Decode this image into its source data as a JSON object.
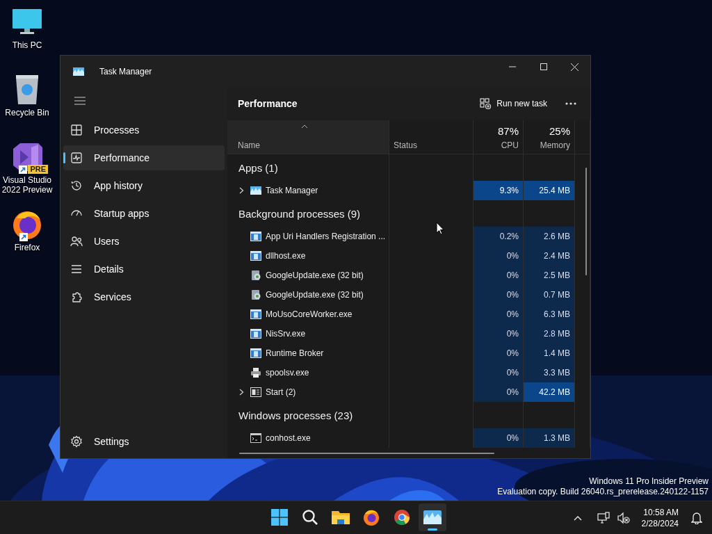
{
  "desktop": {
    "icons": [
      {
        "label": "This PC",
        "shortcut": false
      },
      {
        "label": "Recycle Bin",
        "shortcut": false
      },
      {
        "label": "Visual Studio 2022 Preview",
        "shortcut": true,
        "badge": "PRE"
      },
      {
        "label": "Firefox",
        "shortcut": true
      }
    ]
  },
  "window": {
    "title": "Task Manager"
  },
  "sidebar": {
    "items": [
      {
        "label": "Processes",
        "selected": false
      },
      {
        "label": "Performance",
        "selected": true
      },
      {
        "label": "App history",
        "selected": false
      },
      {
        "label": "Startup apps",
        "selected": false
      },
      {
        "label": "Users",
        "selected": false
      },
      {
        "label": "Details",
        "selected": false
      },
      {
        "label": "Services",
        "selected": false
      }
    ],
    "settings": "Settings"
  },
  "page": {
    "title": "Performance",
    "run_new_task": "Run new task"
  },
  "table": {
    "columns": [
      {
        "label": "Name"
      },
      {
        "label": "Status"
      },
      {
        "label": "CPU",
        "total": "87%"
      },
      {
        "label": "Memory",
        "total": "25%"
      }
    ],
    "groups": [
      {
        "title": "Apps (1)",
        "rows": [
          {
            "name": "Task Manager",
            "expandable": true,
            "cpu": "9.3%",
            "memory": "25.4 MB",
            "cpu_high": true,
            "mem_high": true
          }
        ]
      },
      {
        "title": "Background processes (9)",
        "rows": [
          {
            "name": "App Uri Handlers Registration ...",
            "expandable": false,
            "cpu": "0.2%",
            "memory": "2.6 MB",
            "cpu_high": false,
            "mem_high": false
          },
          {
            "name": "dllhost.exe",
            "expandable": false,
            "cpu": "0%",
            "memory": "2.4 MB",
            "cpu_high": false,
            "mem_high": false
          },
          {
            "name": "GoogleUpdate.exe (32 bit)",
            "expandable": false,
            "cpu": "0%",
            "memory": "2.5 MB",
            "cpu_high": false,
            "mem_high": false
          },
          {
            "name": "GoogleUpdate.exe (32 bit)",
            "expandable": false,
            "cpu": "0%",
            "memory": "0.7 MB",
            "cpu_high": false,
            "mem_high": false
          },
          {
            "name": "MoUsoCoreWorker.exe",
            "expandable": false,
            "cpu": "0%",
            "memory": "6.3 MB",
            "cpu_high": false,
            "mem_high": false
          },
          {
            "name": "NisSrv.exe",
            "expandable": false,
            "cpu": "0%",
            "memory": "2.8 MB",
            "cpu_high": false,
            "mem_high": false
          },
          {
            "name": "Runtime Broker",
            "expandable": false,
            "cpu": "0%",
            "memory": "1.4 MB",
            "cpu_high": false,
            "mem_high": false
          },
          {
            "name": "spoolsv.exe",
            "expandable": false,
            "cpu": "0%",
            "memory": "3.3 MB",
            "cpu_high": false,
            "mem_high": false
          },
          {
            "name": "Start (2)",
            "expandable": true,
            "cpu": "0%",
            "memory": "42.2 MB",
            "cpu_high": false,
            "mem_high": true
          }
        ]
      },
      {
        "title": "Windows processes (23)",
        "rows": [
          {
            "name": "conhost.exe",
            "expandable": false,
            "cpu": "0%",
            "memory": "1.3 MB",
            "cpu_high": false,
            "mem_high": false
          }
        ]
      }
    ]
  },
  "watermark": {
    "line_1": "Windows 11 Pro Insider Preview",
    "line_2": "Evaluation copy. Build 26040.rs_prerelease.240122-1157"
  },
  "taskbar": {
    "apps": [
      {
        "active": false
      },
      {
        "active": false
      },
      {
        "active": false
      },
      {
        "active": false
      },
      {
        "active": false
      },
      {
        "active": true
      }
    ],
    "clock": {
      "time": "10:58 AM",
      "date": "2/28/2024"
    }
  }
}
